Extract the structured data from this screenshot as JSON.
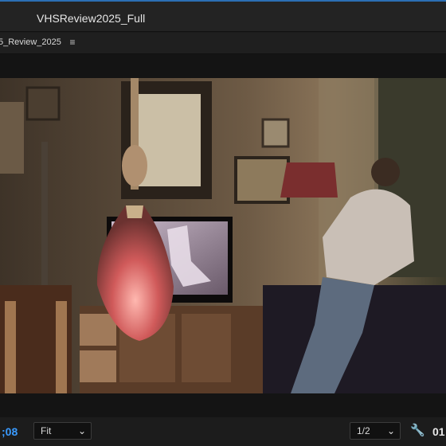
{
  "window": {
    "title": "VHSReview2025_Full"
  },
  "sequence": {
    "name": "5_Review_2025",
    "menu_icon": "hamburger-menu-icon"
  },
  "viewer": {
    "frame_description_icon": "video-frame"
  },
  "controls": {
    "timecode_left": ";08",
    "fit_value": "Fit",
    "resolution_value": "1/2",
    "timecode_right": "01",
    "settings_icon": "wrench-icon"
  },
  "colors": {
    "accent": "#3a9bff",
    "top_line": "#2c6fb4",
    "panel_bg": "#1c1c1c"
  }
}
